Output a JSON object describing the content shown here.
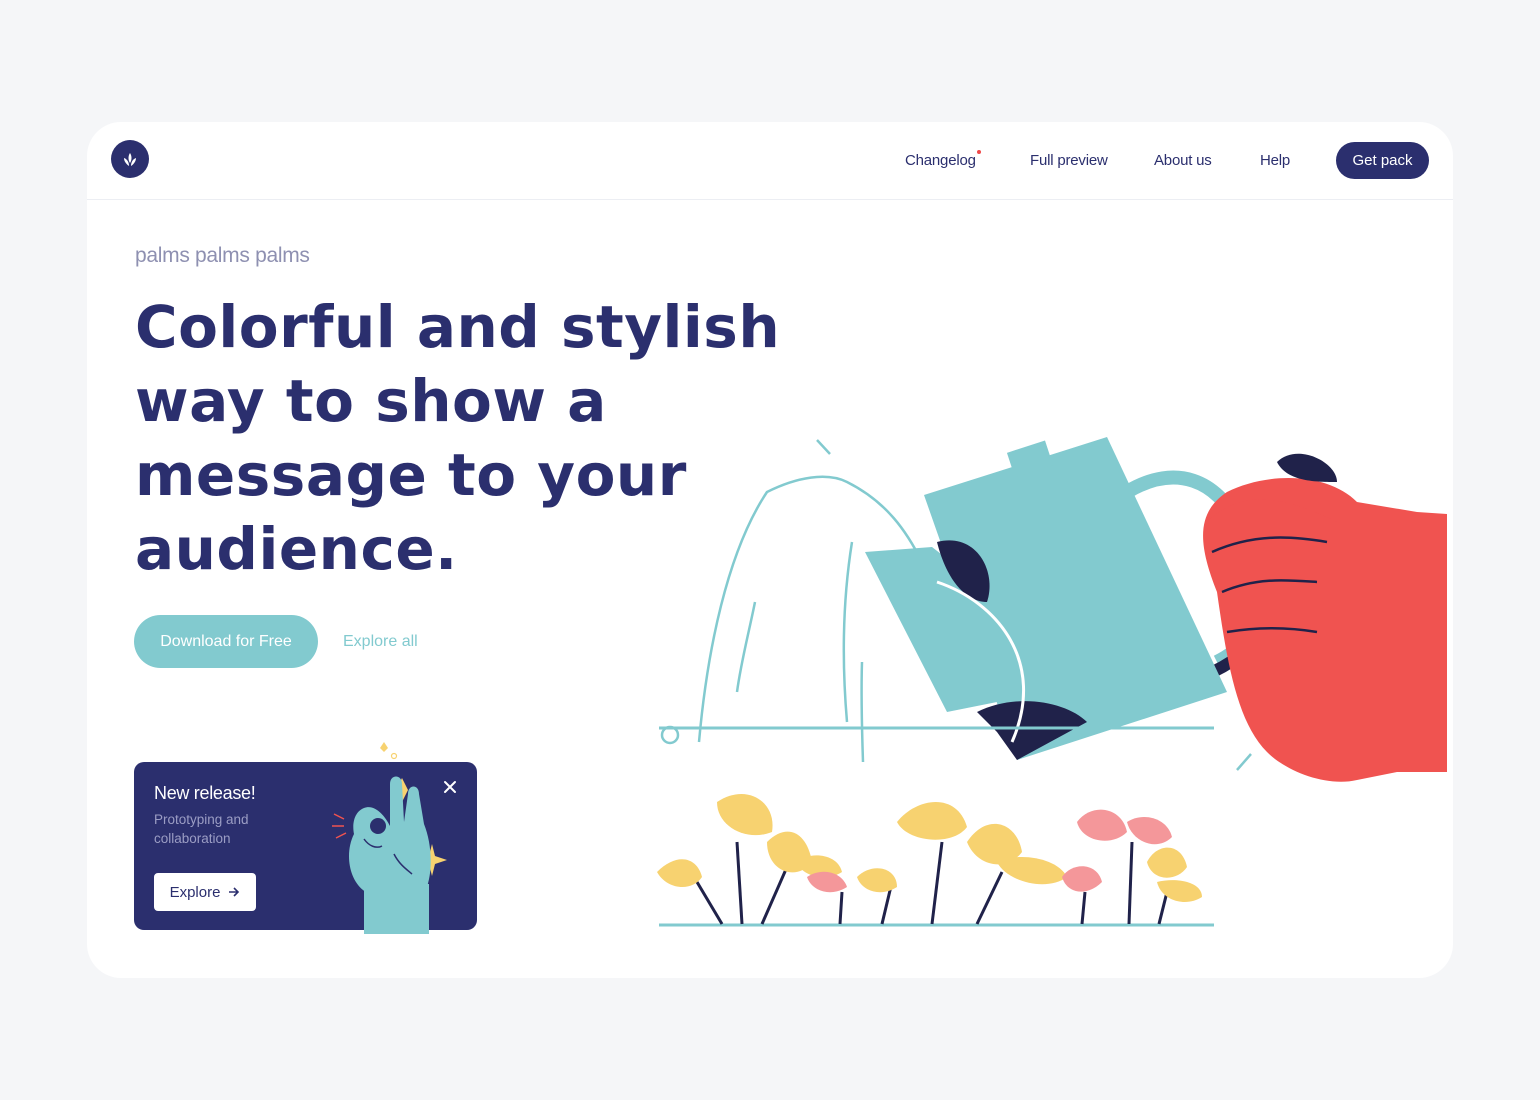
{
  "nav": {
    "links": [
      "Changelog",
      "Full preview",
      "About us",
      "Help"
    ],
    "cta": "Get pack"
  },
  "hero": {
    "eyebrow": "palms palms palms",
    "headline": "Colorful and stylish way to show a message to your audience.",
    "primary_button": "Download for Free",
    "secondary_link": "Explore all"
  },
  "release_card": {
    "title": "New release!",
    "subtitle": "Prototyping and collaboration",
    "button": "Explore",
    "close_icon": "close-icon",
    "arrow_icon": "arrow-right-icon"
  },
  "colors": {
    "navy": "#2b2f6e",
    "teal": "#82cacf",
    "coral": "#f05350",
    "yellow": "#f7d270",
    "pink": "#f4979a",
    "background": "#f5f6f8"
  }
}
